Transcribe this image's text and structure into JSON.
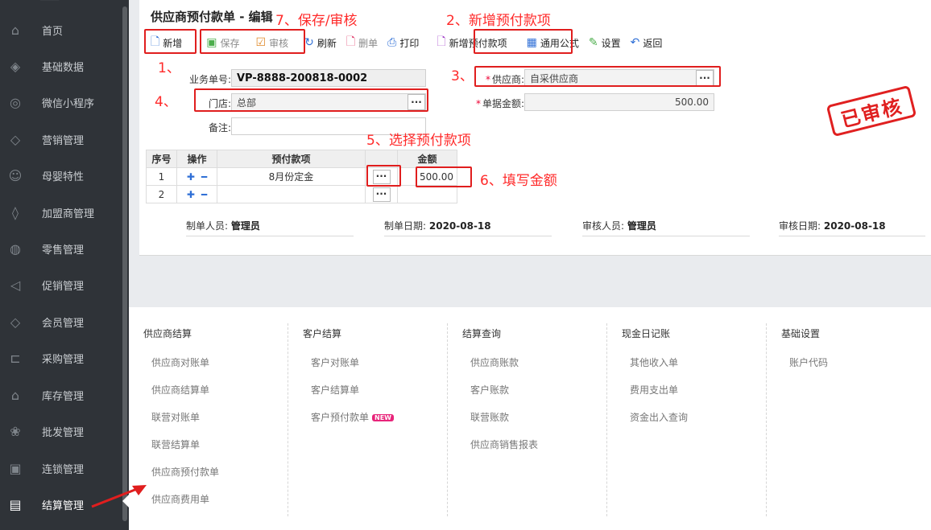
{
  "sidebar": {
    "items": [
      {
        "label": "首页",
        "icon": "home-icon",
        "glyph": "⌂"
      },
      {
        "label": "基础数据",
        "icon": "layers-icon",
        "glyph": "◈"
      },
      {
        "label": "微信小程序",
        "icon": "wechat-icon",
        "glyph": "◎"
      },
      {
        "label": "营销管理",
        "icon": "diamond-icon",
        "glyph": "◇"
      },
      {
        "label": "母婴特性",
        "icon": "smile-icon",
        "glyph": "☺"
      },
      {
        "label": "加盟商管理",
        "icon": "tag-icon",
        "glyph": "◊"
      },
      {
        "label": "零售管理",
        "icon": "compass-icon",
        "glyph": "◍"
      },
      {
        "label": "促销管理",
        "icon": "badge-icon",
        "glyph": "◁"
      },
      {
        "label": "会员管理",
        "icon": "gem-icon",
        "glyph": "◇"
      },
      {
        "label": "采购管理",
        "icon": "cart-icon",
        "glyph": "⊏"
      },
      {
        "label": "库存管理",
        "icon": "warehouse-icon",
        "glyph": "⌂"
      },
      {
        "label": "批发管理",
        "icon": "boxes-icon",
        "glyph": "❀"
      },
      {
        "label": "连锁管理",
        "icon": "store-icon",
        "glyph": "▣"
      },
      {
        "label": "结算管理",
        "icon": "settlement-icon",
        "glyph": "▤"
      }
    ],
    "active_index": 13
  },
  "page": {
    "title": "供应商预付款单 - 编辑",
    "stamp": "已审核"
  },
  "toolbar": {
    "new": "新增",
    "save": "保存",
    "audit": "审核",
    "refresh": "刷新",
    "delete": "删单",
    "print": "打印",
    "add_prepay": "新增预付款项",
    "formula": "通用公式",
    "settings": "设置",
    "back": "返回"
  },
  "form": {
    "doc_no_label": "业务单号:",
    "doc_no": "VP-8888-200818-0002",
    "store_label": "门店:",
    "store": "总部",
    "remark_label": "备注:",
    "remark": "",
    "supplier_label": "供应商:",
    "supplier": "自采供应商",
    "amount_label": "单据金额:",
    "amount": "500.00"
  },
  "grid": {
    "headers": [
      "序号",
      "操作",
      "预付款项",
      "",
      "金额"
    ],
    "rows": [
      {
        "no": "1",
        "item": "8月份定金",
        "amount": "500.00"
      },
      {
        "no": "2",
        "item": "",
        "amount": ""
      }
    ]
  },
  "footer": {
    "maker_label": "制单人员:",
    "maker": "管理员",
    "make_date_label": "制单日期:",
    "make_date": "2020-08-18",
    "auditor_label": "审核人员:",
    "auditor": "管理员",
    "audit_date_label": "审核日期:",
    "audit_date": "2020-08-18"
  },
  "annotations": {
    "a1": "1、",
    "a2": "2、新增预付款项",
    "a3": "3、",
    "a4": "4、",
    "a5": "5、选择预付款项",
    "a6": "6、填写金额",
    "a7": "7、保存/审核"
  },
  "menu": {
    "columns": [
      {
        "head": "供应商结算",
        "items": [
          "供应商对账单",
          "供应商结算单",
          "联营对账单",
          "联营结算单",
          "供应商预付款单",
          "供应商费用单"
        ]
      },
      {
        "head": "客户结算",
        "items": [
          "客户对账单",
          "客户结算单",
          "客户预付款单"
        ],
        "badge": "NEW"
      },
      {
        "head": "结算查询",
        "items": [
          "供应商账款",
          "客户账款",
          "联营账款",
          "供应商销售报表"
        ]
      },
      {
        "head": "现金日记账",
        "items": [
          "其他收入单",
          "费用支出单",
          "资金出入查询"
        ]
      },
      {
        "head": "基础设置",
        "items": [
          "账户代码"
        ]
      }
    ]
  },
  "colors": {
    "sidebar_bg": "#2f3338",
    "annotation": "#ff2a2a",
    "link_blue": "#2f6fd6",
    "new_badge": "#e8247a"
  }
}
